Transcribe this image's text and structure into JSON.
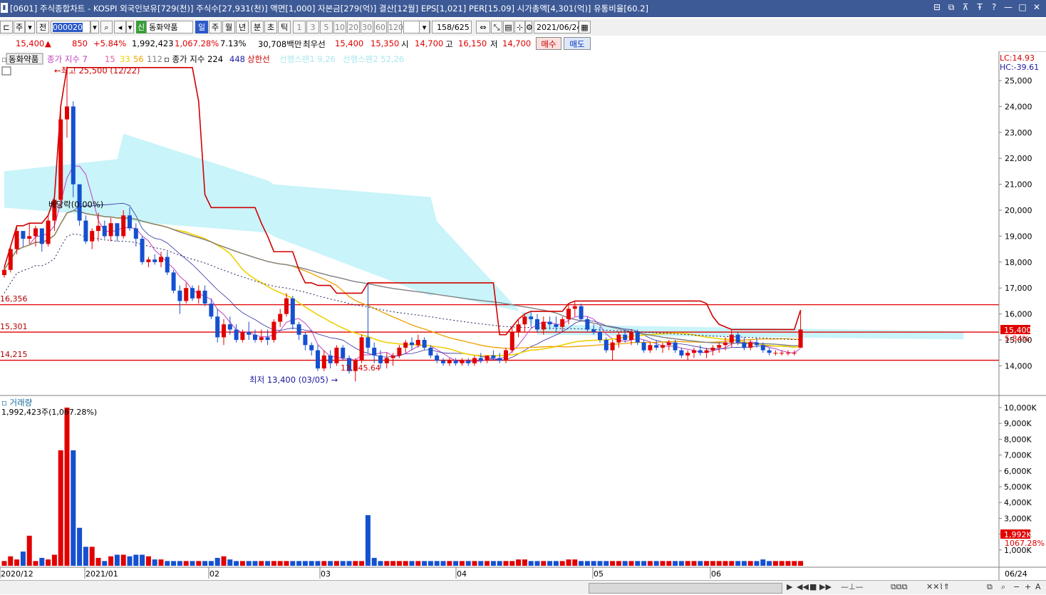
{
  "window": {
    "title": "[0601] 주식종합차트 - KOSPI 외국인보유[729(천)] 주식수[27,931(천)] 액면[1,000] 자본금[279(억)] 결산[12월] EPS[1,021] PER[15.09] 시가총액[4,301(억)] 유통비율[60.2]",
    "buttons": [
      "⊟",
      "⧉",
      "⊼",
      "Ŧ",
      "?",
      "—",
      "□",
      "✕"
    ]
  },
  "toolbar": {
    "period_type": "주",
    "prev_label": "전",
    "stock_code": "000020",
    "stock_badge": "신",
    "stock_name": "동화약품",
    "intervals": [
      "일",
      "주",
      "월",
      "년",
      "분",
      "초",
      "틱"
    ],
    "active_interval": "일",
    "minute_options": [
      "1",
      "3",
      "5",
      "10",
      "20",
      "30",
      "60",
      "120"
    ],
    "count": "158",
    "total": "/625",
    "date": "2021/06/24"
  },
  "quote": {
    "price": "15,400",
    "arrow": "▲",
    "change": "850",
    "change_pct": "+5.84%",
    "volume": "1,992,423",
    "volume_pct": "1,067.28%",
    "turnover": "7.13%",
    "amount": "30,708백만",
    "priority_label": "최우선",
    "ask": "15,400",
    "bid": "15,350",
    "open_label": "시",
    "open": "14,700",
    "high_label": "고",
    "high": "16,150",
    "low_label": "저",
    "low": "14,700",
    "buy_label": "매수",
    "sell_label": "매도"
  },
  "legend": {
    "name": "동화약품",
    "ma_label_1": "종가 지수 7",
    "ma_15": "15",
    "ma_33": "33",
    "ma_56": "56",
    "ma_112": "112",
    "ma_label_2": "종가 지수 224",
    "ma_448": "448",
    "upper_line": "상한선",
    "ichimoku_1": "선행스팬1 9,26",
    "ichimoku_2": "선행스팬2 52,26"
  },
  "annotations": {
    "high": "최고 25,500 (12/22)",
    "low": "최저 13,400 (03/05)",
    "dividend": "배당락(0.00%)",
    "low_value": "13,945.64",
    "hline_1": "16,356",
    "hline_2": "15,301",
    "hline_3": "14,215",
    "lc": "LC:14.93",
    "hc": "HC:-39.61",
    "price_tag": "15,400",
    "pct_tag": "5.84%",
    "vol_title": "거래량",
    "vol_value": "1,992,423주(1,067.28%)",
    "vol_tag": "1,992K",
    "vol_pct_tag": "1067.28%"
  },
  "chart_data": {
    "type": "candlestick",
    "y_price_ticks": [
      "25,000",
      "24,000",
      "23,000",
      "22,000",
      "21,000",
      "20,000",
      "19,000",
      "18,000",
      "17,000",
      "16,000",
      "15,000",
      "14,000"
    ],
    "y_volume_ticks": [
      "10,000K",
      "9,000K",
      "8,000K",
      "7,000K",
      "6,000K",
      "5,000K",
      "4,000K",
      "3,000K",
      "2,000K",
      "1,000K"
    ],
    "x_labels": [
      "2020/12",
      "2021/01",
      "02",
      "03",
      "04",
      "05",
      "06"
    ],
    "last_date": "06/24",
    "candles": [
      [
        17.5,
        17.8,
        17.4,
        17.7
      ],
      [
        17.7,
        18.6,
        17.6,
        18.5
      ],
      [
        18.5,
        19.4,
        18.3,
        19.2
      ],
      [
        19.2,
        19.1,
        18.6,
        18.9
      ],
      [
        18.9,
        19.5,
        18.7,
        19.0
      ],
      [
        19.0,
        19.4,
        18.6,
        19.3
      ],
      [
        19.3,
        19.2,
        18.4,
        18.7
      ],
      [
        18.7,
        19.8,
        18.6,
        19.6
      ],
      [
        19.6,
        20.5,
        19.2,
        20.4
      ],
      [
        20.4,
        24.0,
        20.1,
        23.5
      ],
      [
        23.5,
        25.5,
        22.8,
        24.0
      ],
      [
        24.0,
        24.2,
        20.5,
        21.0
      ],
      [
        21.0,
        20.6,
        19.4,
        19.6
      ],
      [
        19.6,
        19.8,
        18.7,
        18.8
      ],
      [
        18.8,
        19.3,
        18.5,
        19.2
      ],
      [
        19.2,
        19.9,
        18.8,
        19.4
      ],
      [
        19.4,
        19.6,
        18.9,
        19.0
      ],
      [
        19.0,
        19.7,
        18.8,
        19.5
      ],
      [
        19.5,
        19.4,
        18.8,
        19.0
      ],
      [
        19.0,
        20.0,
        18.9,
        19.8
      ],
      [
        19.8,
        20.1,
        19.2,
        19.3
      ],
      [
        19.3,
        19.5,
        18.6,
        18.9
      ],
      [
        18.9,
        19.0,
        17.9,
        18.0
      ],
      [
        18.0,
        18.2,
        17.8,
        18.1
      ],
      [
        18.1,
        18.3,
        17.9,
        18.0
      ],
      [
        18.0,
        18.4,
        17.8,
        18.2
      ],
      [
        18.2,
        18.4,
        17.5,
        17.6
      ],
      [
        17.6,
        17.7,
        16.8,
        16.9
      ],
      [
        16.9,
        17.1,
        16.0,
        16.5
      ],
      [
        16.5,
        17.2,
        16.4,
        17.0
      ],
      [
        17.0,
        17.1,
        16.5,
        16.6
      ],
      [
        16.6,
        17.1,
        16.4,
        16.9
      ],
      [
        16.9,
        17.1,
        16.3,
        16.4
      ],
      [
        16.4,
        16.6,
        15.8,
        15.9
      ],
      [
        15.9,
        16.2,
        14.9,
        15.1
      ],
      [
        15.1,
        15.8,
        14.8,
        15.6
      ],
      [
        15.6,
        15.9,
        15.2,
        15.4
      ],
      [
        15.4,
        15.6,
        14.9,
        15.0
      ],
      [
        15.0,
        15.4,
        14.9,
        15.3
      ],
      [
        15.3,
        15.7,
        15.0,
        15.2
      ],
      [
        15.2,
        15.4,
        14.9,
        15.0
      ],
      [
        15.0,
        15.4,
        14.9,
        15.1
      ],
      [
        15.1,
        15.4,
        14.8,
        15.0
      ],
      [
        15.0,
        15.8,
        14.9,
        15.7
      ],
      [
        15.7,
        16.2,
        15.5,
        16.0
      ],
      [
        16.0,
        16.8,
        15.9,
        16.6
      ],
      [
        16.6,
        16.7,
        15.4,
        15.6
      ],
      [
        15.6,
        15.7,
        15.0,
        15.2
      ],
      [
        15.2,
        15.3,
        14.6,
        14.8
      ],
      [
        14.8,
        14.9,
        14.4,
        14.6
      ],
      [
        14.6,
        14.8,
        13.8,
        13.9
      ],
      [
        13.9,
        14.6,
        13.8,
        14.4
      ],
      [
        14.4,
        14.6,
        13.9,
        14.1
      ],
      [
        14.1,
        14.8,
        14.0,
        14.7
      ],
      [
        14.7,
        14.8,
        14.2,
        14.3
      ],
      [
        14.3,
        14.4,
        13.7,
        13.8
      ],
      [
        13.8,
        14.3,
        13.4,
        14.2
      ],
      [
        14.2,
        15.2,
        14.1,
        15.1
      ],
      [
        15.1,
        17.2,
        14.5,
        14.7
      ],
      [
        14.7,
        14.9,
        14.1,
        14.4
      ],
      [
        14.4,
        14.6,
        13.9,
        14.1
      ],
      [
        14.1,
        14.5,
        13.9,
        14.3
      ],
      [
        14.3,
        14.5,
        14.0,
        14.4
      ],
      [
        14.4,
        14.8,
        14.3,
        14.7
      ],
      [
        14.7,
        15.0,
        14.5,
        14.9
      ],
      [
        14.9,
        15.1,
        14.6,
        14.8
      ],
      [
        14.8,
        15.2,
        14.7,
        15.0
      ],
      [
        15.0,
        15.1,
        14.6,
        14.7
      ],
      [
        14.7,
        14.8,
        14.3,
        14.4
      ],
      [
        14.4,
        14.5,
        14.1,
        14.2
      ],
      [
        14.2,
        14.3,
        14.0,
        14.1
      ],
      [
        14.1,
        14.3,
        14.0,
        14.2
      ],
      [
        14.2,
        14.3,
        14.0,
        14.1
      ],
      [
        14.1,
        14.3,
        14.0,
        14.2
      ],
      [
        14.2,
        14.3,
        14.0,
        14.1
      ],
      [
        14.1,
        14.4,
        14.0,
        14.3
      ],
      [
        14.3,
        14.5,
        14.1,
        14.2
      ],
      [
        14.2,
        14.4,
        14.1,
        14.4
      ],
      [
        14.4,
        14.6,
        14.2,
        14.3
      ],
      [
        14.3,
        14.5,
        14.1,
        14.2
      ],
      [
        14.2,
        14.7,
        14.1,
        14.6
      ],
      [
        14.6,
        15.5,
        14.5,
        15.3
      ],
      [
        15.3,
        15.8,
        15.1,
        15.6
      ],
      [
        15.6,
        16.0,
        15.3,
        15.9
      ],
      [
        15.9,
        16.1,
        15.5,
        15.8
      ],
      [
        15.8,
        16.0,
        15.3,
        15.4
      ],
      [
        15.4,
        15.9,
        15.2,
        15.7
      ],
      [
        15.7,
        15.9,
        15.4,
        15.6
      ],
      [
        15.6,
        15.9,
        15.3,
        15.5
      ],
      [
        15.5,
        15.9,
        15.3,
        15.8
      ],
      [
        15.8,
        16.4,
        15.6,
        16.2
      ],
      [
        16.2,
        16.5,
        15.9,
        16.3
      ],
      [
        16.3,
        16.4,
        15.7,
        15.8
      ],
      [
        15.8,
        15.9,
        15.3,
        15.4
      ],
      [
        15.4,
        15.6,
        15.2,
        15.3
      ],
      [
        15.3,
        15.5,
        14.9,
        15.0
      ],
      [
        15.0,
        15.1,
        14.5,
        14.6
      ],
      [
        14.6,
        15.0,
        14.2,
        14.9
      ],
      [
        14.9,
        15.3,
        14.7,
        15.2
      ],
      [
        15.2,
        15.4,
        14.9,
        15.0
      ],
      [
        15.0,
        15.4,
        14.8,
        15.3
      ],
      [
        15.3,
        15.4,
        14.8,
        14.9
      ],
      [
        14.9,
        15.0,
        14.5,
        14.6
      ],
      [
        14.6,
        14.9,
        14.5,
        14.8
      ],
      [
        14.8,
        15.0,
        14.6,
        14.7
      ],
      [
        14.7,
        14.9,
        14.5,
        14.8
      ],
      [
        14.8,
        15.0,
        14.6,
        14.9
      ],
      [
        14.9,
        15.0,
        14.5,
        14.6
      ],
      [
        14.6,
        14.7,
        14.3,
        14.4
      ],
      [
        14.4,
        14.6,
        14.2,
        14.5
      ],
      [
        14.5,
        14.7,
        14.3,
        14.6
      ],
      [
        14.6,
        14.8,
        14.4,
        14.5
      ],
      [
        14.5,
        14.7,
        14.3,
        14.6
      ],
      [
        14.6,
        14.8,
        14.4,
        14.7
      ],
      [
        14.7,
        14.9,
        14.5,
        14.8
      ],
      [
        14.8,
        15.1,
        14.6,
        14.9
      ],
      [
        14.9,
        15.4,
        14.7,
        15.2
      ],
      [
        15.2,
        15.3,
        14.8,
        14.9
      ],
      [
        14.9,
        15.1,
        14.6,
        14.7
      ],
      [
        14.7,
        15.0,
        14.6,
        14.9
      ],
      [
        14.9,
        15.1,
        14.7,
        14.8
      ],
      [
        14.8,
        14.9,
        14.5,
        14.6
      ],
      [
        14.6,
        14.7,
        14.4,
        14.5
      ],
      [
        14.5,
        14.6,
        14.4,
        14.5
      ],
      [
        14.5,
        14.6,
        14.4,
        14.5
      ],
      [
        14.5,
        14.6,
        14.4,
        14.5
      ],
      [
        14.5,
        14.6,
        14.4,
        14.5
      ],
      [
        14.7,
        16.15,
        14.7,
        15.4
      ]
    ],
    "volumes": [
      0.3,
      0.6,
      0.4,
      0.9,
      1.9,
      0.3,
      0.5,
      0.4,
      0.7,
      7.3,
      10.0,
      7.3,
      2.4,
      1.2,
      1.2,
      0.5,
      0.3,
      0.6,
      0.7,
      0.7,
      0.6,
      0.7,
      0.7,
      0.6,
      0.4,
      0.4,
      0.3,
      0.3,
      0.3,
      0.3,
      0.3,
      0.3,
      0.3,
      0.3,
      0.5,
      0.6,
      0.4,
      0.3,
      0.3,
      0.3,
      0.3,
      0.3,
      0.3,
      0.3,
      0.3,
      0.3,
      0.3,
      0.3,
      0.3,
      0.3,
      0.3,
      0.3,
      0.3,
      0.3,
      0.3,
      0.3,
      0.3,
      0.3,
      3.2,
      0.5,
      0.3,
      0.3,
      0.3,
      0.3,
      0.3,
      0.3,
      0.3,
      0.3,
      0.3,
      0.3,
      0.3,
      0.3,
      0.3,
      0.3,
      0.3,
      0.3,
      0.3,
      0.3,
      0.3,
      0.3,
      0.3,
      0.3,
      0.4,
      0.4,
      0.3,
      0.3,
      0.3,
      0.3,
      0.3,
      0.3,
      0.4,
      0.4,
      0.3,
      0.3,
      0.3,
      0.3,
      0.3,
      0.3,
      0.3,
      0.3,
      0.3,
      0.3,
      0.3,
      0.3,
      0.3,
      0.3,
      0.3,
      0.3,
      0.3,
      0.3,
      0.3,
      0.3,
      0.3,
      0.3,
      0.3,
      0.3,
      0.3,
      0.3,
      0.3,
      0.3,
      0.3,
      0.4,
      0.3,
      0.3,
      0.3,
      0.3,
      0.3,
      0.3,
      0.3,
      0.3,
      0.3,
      2.0
    ],
    "h_lines": [
      16.356,
      15.301,
      14.215
    ],
    "colors": {
      "up": "#e00000",
      "down": "#1450d0",
      "cloud": "#c8f4fa",
      "ma_purple": "#c040c0",
      "ma_yellow": "#f0d000",
      "ma_orange": "#f0a000",
      "ma_gray": "#808080",
      "upper": "#d00000"
    }
  }
}
